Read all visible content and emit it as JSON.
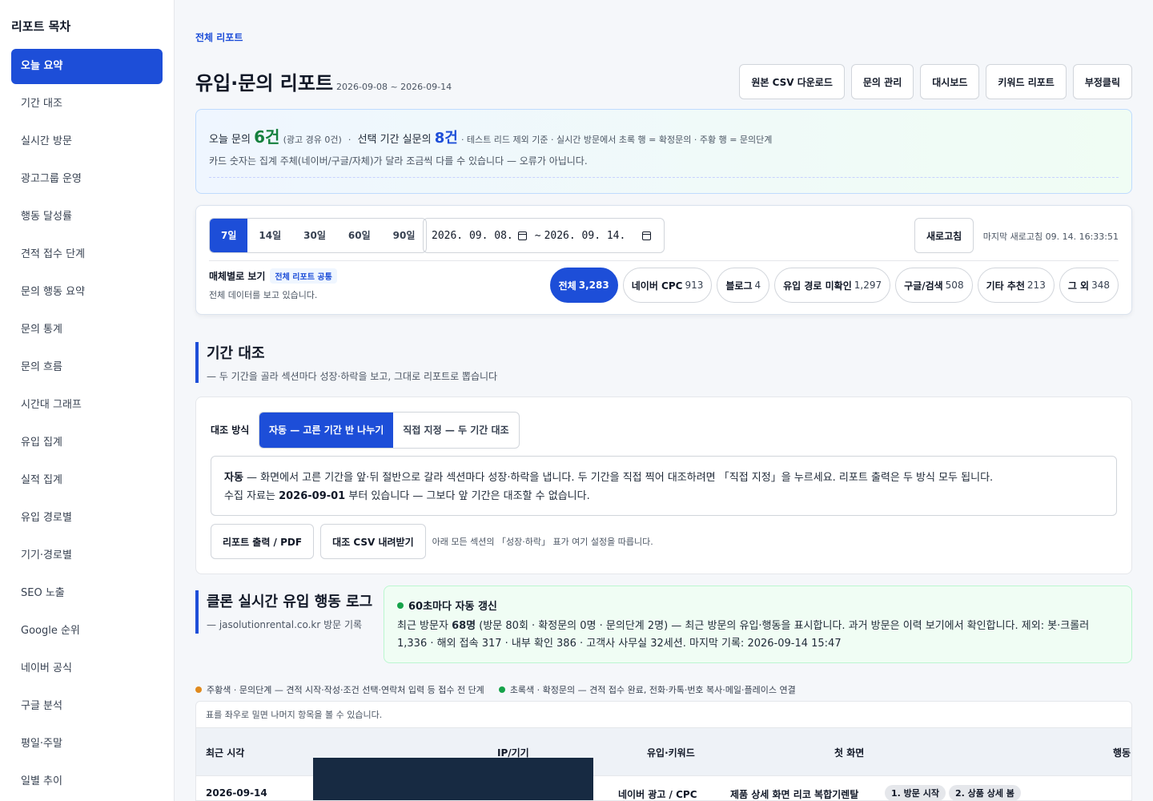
{
  "sidebar": {
    "title": "리포트 목차",
    "items": [
      {
        "label": "오늘 요약",
        "active": true
      },
      {
        "label": "기간 대조"
      },
      {
        "label": "실시간 방문"
      },
      {
        "label": "광고그룹 운영"
      },
      {
        "label": "행동 달성률"
      },
      {
        "label": "견적 접수 단계"
      },
      {
        "label": "문의 행동 요약"
      },
      {
        "label": "문의 통계"
      },
      {
        "label": "문의 흐름"
      },
      {
        "label": "시간대 그래프"
      },
      {
        "label": "유입 집계"
      },
      {
        "label": "실적 집계"
      },
      {
        "label": "유입 경로별"
      },
      {
        "label": "기기·경로별"
      },
      {
        "label": "SEO 노출"
      },
      {
        "label": "Google 순위"
      },
      {
        "label": "네이버 공식"
      },
      {
        "label": "구글 분석"
      },
      {
        "label": "평일·주말"
      },
      {
        "label": "일별 추이"
      }
    ]
  },
  "header": {
    "breadcrumb": "전체 리포트",
    "title": "유입·문의 리포트",
    "range": "2026-09-08 ~ 2026-09-14",
    "buttons": [
      "원본 CSV 다운로드",
      "문의 관리",
      "대시보드",
      "키워드 리포트",
      "부정클릭"
    ]
  },
  "summary": {
    "today_label": "오늘 문의",
    "today_count": "6건",
    "today_ad": "(광고 경유 0건)",
    "sep": "·",
    "period_label": "선택 기간 실문의",
    "period_count": "8건",
    "note": "· 테스트 리드 제외 기준 · 실시간 방문에서 초록 행 = 확정문의 · 주황 행 = 문의단계",
    "line2": "카드 숫자는 집계 주체(네이버/구글/자체)가 달라 조금씩 다를 수 있습니다 — 오류가 아닙니다."
  },
  "filters": {
    "periods": [
      "7일",
      "14일",
      "30일",
      "60일",
      "90일"
    ],
    "active_period": "7일",
    "date_from": "2026. 09. 08.",
    "date_sep": "~",
    "date_to": "2026. 09. 14.",
    "refresh_label": "새로고침",
    "last_refresh": "마지막 새로고침 09. 14. 16:33:51",
    "media_label": "매체별로 보기",
    "media_tag": "전체 리포트 공통",
    "media_sub": "전체 데이터를 보고 있습니다.",
    "chips": [
      {
        "label": "전체",
        "count": "3,283",
        "active": true
      },
      {
        "label": "네이버 CPC",
        "count": "913"
      },
      {
        "label": "블로그",
        "count": "4"
      },
      {
        "label": "유입 경로 미확인",
        "count": "1,297"
      },
      {
        "label": "구글/검색",
        "count": "508"
      },
      {
        "label": "기타 추천",
        "count": "213"
      },
      {
        "label": "그 외",
        "count": "348"
      }
    ]
  },
  "compare": {
    "title": "기간 대조",
    "subtitle": "— 두 기간을 골라 섹션마다 성장·하락을 보고, 그대로 리포트로 뽑습니다",
    "mode_label": "대조 방식",
    "modes": [
      "자동 — 고른 기간 반 나누기",
      "직접 지정 — 두 기간 대조"
    ],
    "info_strong": "자동",
    "info_text": " — 화면에서 고른 기간을 앞·뒤 절반으로 갈라 섹션마다 성장·하락을 냅니다. 두 기간을 직접 찍어 대조하려면 「직접 지정」을 누르세요. 리포트 출력은 두 방식 모두 됩니다.",
    "info2_pre": "수집 자료는 ",
    "info2_date": "2026-09-01",
    "info2_post": " 부터 있습니다 — 그보다 앞 기간은 대조할 수 없습니다.",
    "btn_pdf": "리포트 출력 / PDF",
    "btn_csv": "대조 CSV 내려받기",
    "note": "아래 모든 섹션의 「성장·하락」 표가 여기 설정을 따릅니다."
  },
  "live": {
    "title": "클론 실시간 유입 행동 로그",
    "subtitle": "— jasolutionrental.co.kr 방문 기록",
    "status": "60초마다 자동 갱신",
    "body_pre": "최근 방문자 ",
    "visitors": "68명",
    "body_post": " (방문 80회 · 확정문의 0명 · 문의단계 2명) — 최근 방문의 유입·행동을 표시합니다. 과거 방문은 이력 보기에서 확인합니다. 제외: 봇·크롤러 1,336 · 해외 접속 317 · 내부 확인 386 · 고객사 사무실 32세션. 마지막 기록: 2026-09-14 15:47",
    "legend_orange": "주황색 · 문의단계 — 견적 시작·작성·조건 선택·연락처 입력 등 접수 전 단계",
    "legend_green": "초록색 · 확정문의 — 견적 접수 완료, 전화·카톡·번호 복사·메일·플레이스 연결",
    "scroll_hint": "표를 좌우로 밀면 나머지 항목을 볼 수 있습니다.",
    "columns": [
      "최근 시각",
      "IP/기기",
      "유입·키워드",
      "첫 화면",
      "행동"
    ],
    "row": {
      "time": "2026-09-14",
      "source": "네이버 광고 / CPC",
      "first_page": "제품 상세 화면 리코 복합기렌탈",
      "steps": [
        "1. 방문 시작",
        "2. 상품 상세 봄"
      ]
    }
  },
  "colors": {
    "accent": "#1d4ed8",
    "green": "#15803d",
    "orange": "#e08a1e",
    "live_green": "#16a34a"
  }
}
